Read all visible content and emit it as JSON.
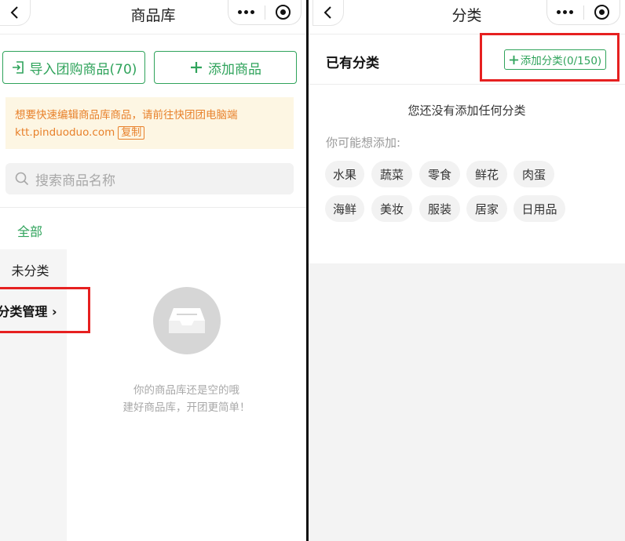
{
  "left": {
    "nav": {
      "title": "商品库"
    },
    "buttons": {
      "import_label": "导入团购商品(70)",
      "add_label": "添加商品"
    },
    "notice": {
      "line1": "想要快速编辑商品库商品，请前往快团团电脑端",
      "line2": "ktt.pinduoduo.com",
      "copy_label": "复制"
    },
    "search": {
      "placeholder": "搜索商品名称"
    },
    "categories": {
      "all": "全部",
      "uncategorized": "未分类",
      "manage": "分类管理",
      "manage_chevron": "›"
    },
    "empty": {
      "line1": "你的商品库还是空的哦",
      "line2": "建好商品库，开团更简单！"
    }
  },
  "right": {
    "nav": {
      "title": "分类"
    },
    "header": {
      "title": "已有分类",
      "add_label": "添加分类(0/150)"
    },
    "empty_text": "您还没有添加任何分类",
    "hint": "你可能想添加:",
    "suggestions": [
      "水果",
      "蔬菜",
      "零食",
      "鲜花",
      "肉蛋",
      "海鲜",
      "美妆",
      "服装",
      "居家",
      "日用品"
    ]
  },
  "colors": {
    "accent": "#2fa35b",
    "notice_text": "#e8812b",
    "notice_bg": "#fdf6e3",
    "highlight": "#e62020"
  }
}
